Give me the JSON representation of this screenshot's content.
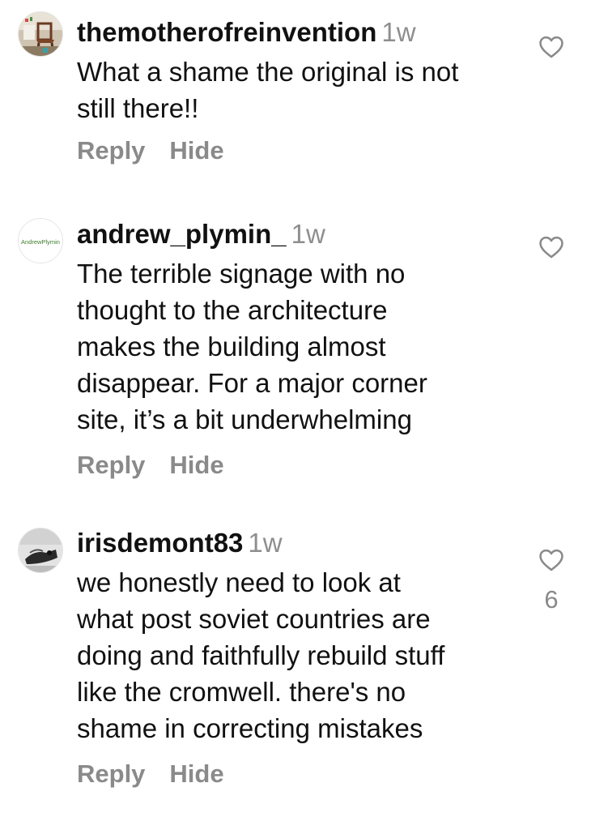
{
  "colors": {
    "text": "#111111",
    "secondary": "#8a8a8a",
    "background": "#ffffff"
  },
  "comments": [
    {
      "avatar_icon": "avatar-chair-photo",
      "username": "themotherofreinvention",
      "time": "1w",
      "text": "What a shame the original is not\nstill there!!",
      "reply_label": "Reply",
      "hide_label": "Hide",
      "like_icon": "heart-icon",
      "likes": ""
    },
    {
      "avatar_icon": "avatar-logo",
      "avatar_text": "AndrewPlymin",
      "username": "andrew_plymin_",
      "time": "1w",
      "text": "The terrible signage with no\nthought to the architecture\nmakes the building almost\ndisappear. For a major corner\nsite, it’s a bit underwhelming",
      "reply_label": "Reply",
      "hide_label": "Hide",
      "like_icon": "heart-icon",
      "likes": ""
    },
    {
      "avatar_icon": "avatar-grey-photo",
      "username": "irisdemont83",
      "time": "1w",
      "text": "we honestly need to look at\nwhat post soviet countries are\ndoing and faithfully rebuild stuff\nlike the cromwell. there's no\nshame in correcting mistakes",
      "reply_label": "Reply",
      "hide_label": "Hide",
      "like_icon": "heart-icon",
      "likes": "6"
    }
  ]
}
